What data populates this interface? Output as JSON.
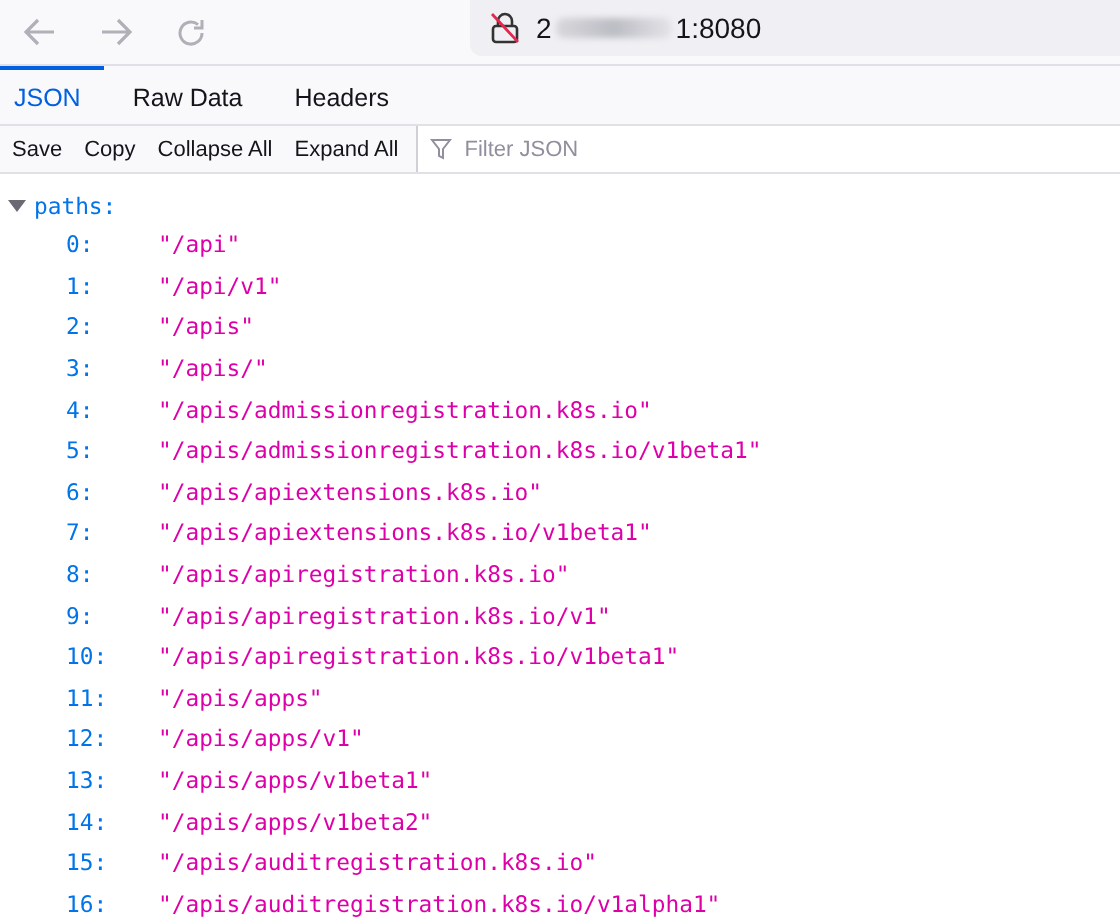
{
  "address_bar": {
    "url_start": "2",
    "url_end": "1:8080"
  },
  "tabs": [
    {
      "label": "JSON",
      "selected": true
    },
    {
      "label": "Raw Data",
      "selected": false
    },
    {
      "label": "Headers",
      "selected": false
    }
  ],
  "toolbar": {
    "buttons": [
      "Save",
      "Copy",
      "Collapse All",
      "Expand All"
    ],
    "filter": {
      "placeholder": "Filter JSON"
    }
  },
  "tree": {
    "key": "paths:",
    "expanded": true,
    "items": [
      {
        "index": "0:",
        "value": "\"/api\""
      },
      {
        "index": "1:",
        "value": "\"/api/v1\""
      },
      {
        "index": "2:",
        "value": "\"/apis\""
      },
      {
        "index": "3:",
        "value": "\"/apis/\""
      },
      {
        "index": "4:",
        "value": "\"/apis/admissionregistration.k8s.io\""
      },
      {
        "index": "5:",
        "value": "\"/apis/admissionregistration.k8s.io/v1beta1\""
      },
      {
        "index": "6:",
        "value": "\"/apis/apiextensions.k8s.io\""
      },
      {
        "index": "7:",
        "value": "\"/apis/apiextensions.k8s.io/v1beta1\""
      },
      {
        "index": "8:",
        "value": "\"/apis/apiregistration.k8s.io\""
      },
      {
        "index": "9:",
        "value": "\"/apis/apiregistration.k8s.io/v1\""
      },
      {
        "index": "10:",
        "value": "\"/apis/apiregistration.k8s.io/v1beta1\""
      },
      {
        "index": "11:",
        "value": "\"/apis/apps\""
      },
      {
        "index": "12:",
        "value": "\"/apis/apps/v1\""
      },
      {
        "index": "13:",
        "value": "\"/apis/apps/v1beta1\""
      },
      {
        "index": "14:",
        "value": "\"/apis/apps/v1beta2\""
      },
      {
        "index": "15:",
        "value": "\"/apis/auditregistration.k8s.io\""
      },
      {
        "index": "16:",
        "value": "\"/apis/auditregistration.k8s.io/v1alpha1\""
      }
    ]
  }
}
